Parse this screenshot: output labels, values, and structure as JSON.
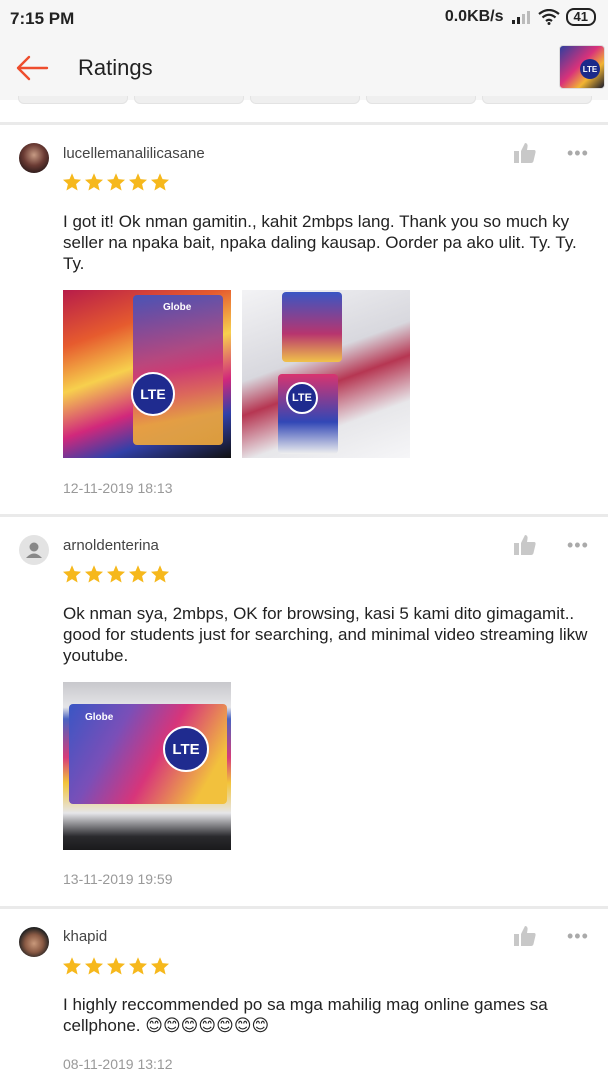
{
  "status_bar": {
    "time": "7:15 PM",
    "speed": "0.0KB/s",
    "battery": "41"
  },
  "header": {
    "title": "Ratings"
  },
  "reviews": [
    {
      "username": "lucellemanalilicasane",
      "rating": 5,
      "text": "I got it! Ok nman gamitin., kahit 2mbps lang. Thank you so much ky seller na npaka bait, npaka daling kausap. Oorder pa ako ulit. Ty. Ty. Ty.",
      "date": "12-11-2019 18:13",
      "photo_labels": [
        "LTE",
        "LTE"
      ]
    },
    {
      "username": "arnoldenterina",
      "rating": 5,
      "text": "Ok nman sya, 2mbps, OK for browsing, kasi 5 kami dito gimagamit.. good for students just for searching, and minimal video streaming likw youtube.",
      "date": "13-11-2019 19:59",
      "photo_labels": [
        "LTE"
      ]
    },
    {
      "username": "khapid",
      "rating": 5,
      "text": "I highly reccommended po sa mga mahilig mag online games sa cellphone. 😊😊😊😊😊😊😊",
      "date": "08-11-2019 13:12"
    }
  ],
  "icons": {
    "back": "arrow-left-icon",
    "like": "thumbs-up-icon",
    "more": "more-dots-icon",
    "star": "star-icon"
  },
  "colors": {
    "accent": "#ee4d2d",
    "star": "#f6b81c",
    "date": "#999999"
  }
}
